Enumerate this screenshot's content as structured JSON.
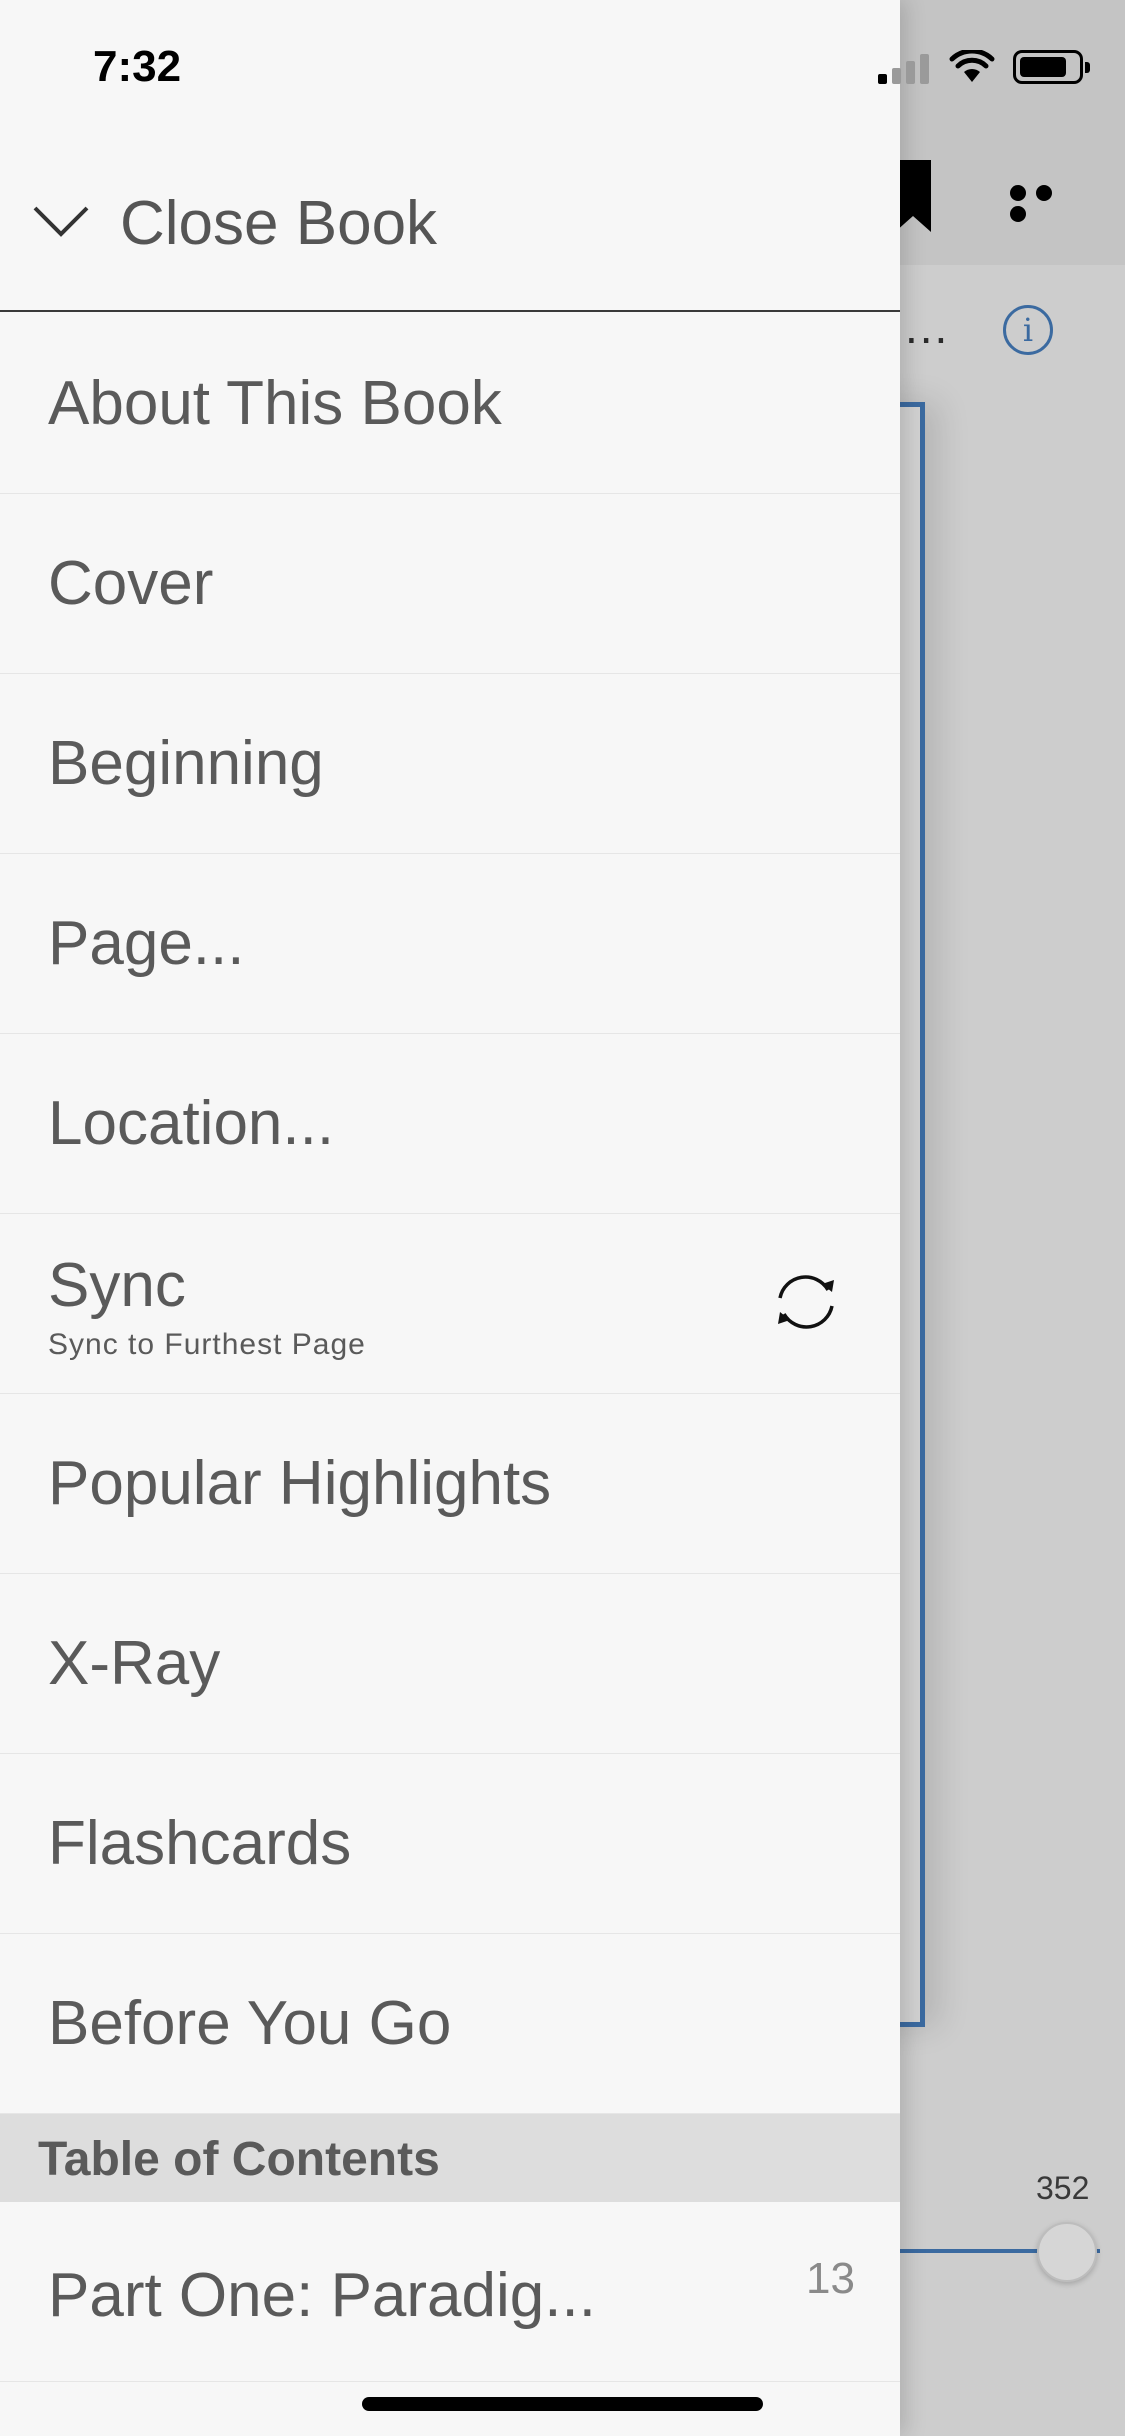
{
  "status_bar": {
    "time": "7:32"
  },
  "drawer": {
    "close_label": "Close Book",
    "menu_items": [
      {
        "label": "About This Book"
      },
      {
        "label": "Cover"
      },
      {
        "label": "Beginning"
      },
      {
        "label": "Page..."
      },
      {
        "label": "Location..."
      },
      {
        "label": "Sync",
        "sublabel": "Sync to Furthest Page",
        "icon": "sync-icon"
      },
      {
        "label": "Popular Highlights"
      },
      {
        "label": "X-Ray"
      },
      {
        "label": "Flashcards"
      },
      {
        "label": "Before You Go"
      }
    ],
    "toc_header": "Table of Contents",
    "toc_items": [
      {
        "label": "Part One: Paradig...",
        "page": "13"
      }
    ]
  },
  "reader": {
    "title_ellipsis": "...",
    "slider_page": "352"
  },
  "colors": {
    "accent": "#3b6aa0",
    "drawer_bg": "#f7f7f7",
    "toc_header_bg": "#dddddd",
    "text": "#5a5a5a"
  }
}
